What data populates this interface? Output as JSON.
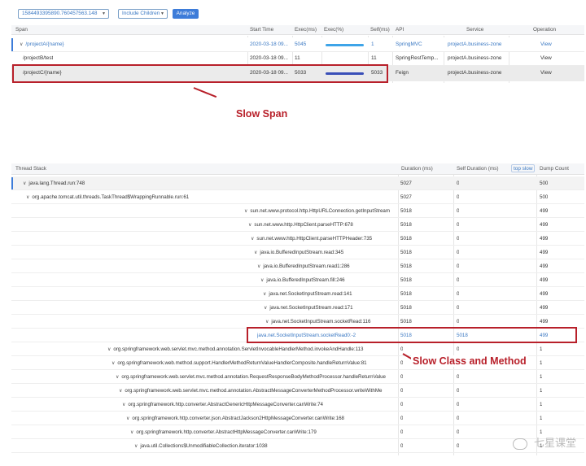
{
  "toolbar": {
    "trace_select": "1584493395890.760457563.148",
    "include_select": "Include Children",
    "analyze_label": "Analyze"
  },
  "span_table": {
    "headers": {
      "span": "Span",
      "start": "Start Time",
      "exec_ms": "Exec(ms)",
      "exec_pct": "Exec(%)",
      "self_ms": "Self(ms)",
      "api": "API",
      "service": "Service",
      "operation": "Operation"
    },
    "rows": [
      {
        "span": "/projectA/{name}",
        "start": "2020-03-18 09...",
        "exec_ms": "5045",
        "exec_pct": 1.0,
        "self_ms": "1",
        "api": "SpringMVC",
        "service": "projectA.business-zone",
        "operation": "View"
      },
      {
        "span": "/projectB/test",
        "start": "2020-03-18 09...",
        "exec_ms": "11",
        "exec_pct": 0.0,
        "self_ms": "11",
        "api": "SpringRestTemp...",
        "service": "projectA.business-zone",
        "operation": "View"
      },
      {
        "span": "/projectC/{name}",
        "start": "2020-03-18 09...",
        "exec_ms": "5033",
        "exec_pct": 1.0,
        "self_ms": "5033",
        "api": "Feign",
        "service": "projectA.business-zone",
        "operation": "View"
      }
    ]
  },
  "annotations": {
    "slow_span": "Slow Span",
    "slow_method": "Slow Class and Method"
  },
  "thread_table": {
    "headers": {
      "stack": "Thread Stack",
      "duration": "Duration (ms)",
      "self_duration": "Self Duration (ms)",
      "top_slow": "top slow",
      "dump_count": "Dump Count"
    },
    "rows": [
      {
        "label": "java.lang.Thread.run:748",
        "duration": "5027",
        "self": "0",
        "dump": "500"
      },
      {
        "label": "org.apache.tomcat.util.threads.TaskThread$WrappingRunnable.run:61",
        "duration": "5027",
        "self": "0",
        "dump": "500"
      },
      {
        "label": "sun.net.www.protocol.http.HttpURLConnection.getInputStream",
        "duration": "5018",
        "self": "0",
        "dump": "499"
      },
      {
        "label": "sun.net.www.http.HttpClient.parseHTTP:678",
        "duration": "5018",
        "self": "0",
        "dump": "499"
      },
      {
        "label": "sun.net.www.http.HttpClient.parseHTTPHeader:735",
        "duration": "5018",
        "self": "0",
        "dump": "499"
      },
      {
        "label": "java.io.BufferedInputStream.read:345",
        "duration": "5018",
        "self": "0",
        "dump": "499"
      },
      {
        "label": "java.io.BufferedInputStream.read1:286",
        "duration": "5018",
        "self": "0",
        "dump": "499"
      },
      {
        "label": "java.io.BufferedInputStream.fill:246",
        "duration": "5018",
        "self": "0",
        "dump": "499"
      },
      {
        "label": "java.net.SocketInputStream.read:141",
        "duration": "5018",
        "self": "0",
        "dump": "499"
      },
      {
        "label": "java.net.SocketInputStream.read:171",
        "duration": "5018",
        "self": "0",
        "dump": "499"
      },
      {
        "label": "java.net.SocketInputStream.socketRead:116",
        "duration": "5018",
        "self": "0",
        "dump": "499"
      },
      {
        "label": "java.net.SocketInputStream.socketRead0:-2",
        "duration": "5018",
        "self": "5018",
        "dump": "499"
      },
      {
        "label": "org.springframework.web.servlet.mvc.method.annotation.ServletInvocableHandlerMethod.invokeAndHandle:113",
        "duration": "0",
        "self": "0",
        "dump": "1"
      },
      {
        "label": "org.springframework.web.method.support.HandlerMethodReturnValueHandlerComposite.handleReturnValue:81",
        "duration": "0",
        "self": "0",
        "dump": "1"
      },
      {
        "label": "org.springframework.web.servlet.mvc.method.annotation.RequestResponseBodyMethodProcessor.handleReturnValue",
        "duration": "0",
        "self": "0",
        "dump": "1"
      },
      {
        "label": "org.springframework.web.servlet.mvc.method.annotation.AbstractMessageConverterMethodProcessor.writeWithMe",
        "duration": "0",
        "self": "0",
        "dump": "1"
      },
      {
        "label": "org.springframework.http.converter.AbstractGenericHttpMessageConverter.canWrite:74",
        "duration": "0",
        "self": "0",
        "dump": "1"
      },
      {
        "label": "org.springframework.http.converter.json.AbstractJackson2HttpMessageConverter.canWrite:168",
        "duration": "0",
        "self": "0",
        "dump": "1"
      },
      {
        "label": "org.springframework.http.converter.AbstractHttpMessageConverter.canWrite:179",
        "duration": "0",
        "self": "0",
        "dump": "1"
      },
      {
        "label": "java.util.Collections$UnmodifiableCollection.iterator:1038",
        "duration": "0",
        "self": "0",
        "dump": "1"
      }
    ]
  },
  "watermark": "七星课堂",
  "colors": {
    "accent": "#3d7cd9",
    "highlight": "#b8202a",
    "bar_blue": "#3ea4e8",
    "bar_dark": "#3a4fb8"
  }
}
